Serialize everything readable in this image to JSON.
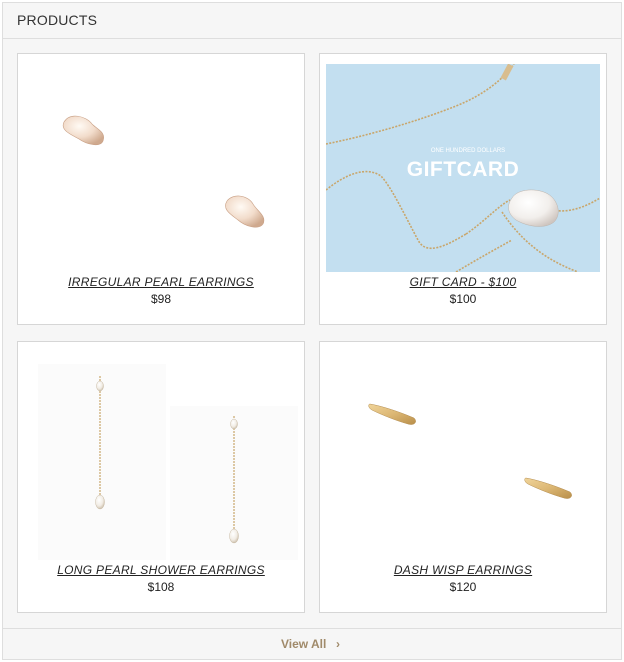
{
  "panel": {
    "title": "PRODUCTS",
    "view_all_label": "View All",
    "view_all_icon": "chevron-right-icon"
  },
  "products": [
    {
      "name": "IRREGULAR PEARL EARRINGS",
      "price": "$98"
    },
    {
      "name": "GIFT CARD - $100",
      "price": "$100"
    },
    {
      "name": "LONG PEARL SHOWER EARRINGS",
      "price": "$108"
    },
    {
      "name": "DASH WISP EARRINGS",
      "price": "$120"
    }
  ],
  "gift_card_image": {
    "small_text": "ONE HUNDRED DOLLARS",
    "big_text": "GIFTCARD"
  },
  "colors": {
    "accent": "#a08a6a",
    "gift_card_bg": "#c3dff0",
    "gold": "#c9a66b",
    "border": "#d6d6d6"
  }
}
